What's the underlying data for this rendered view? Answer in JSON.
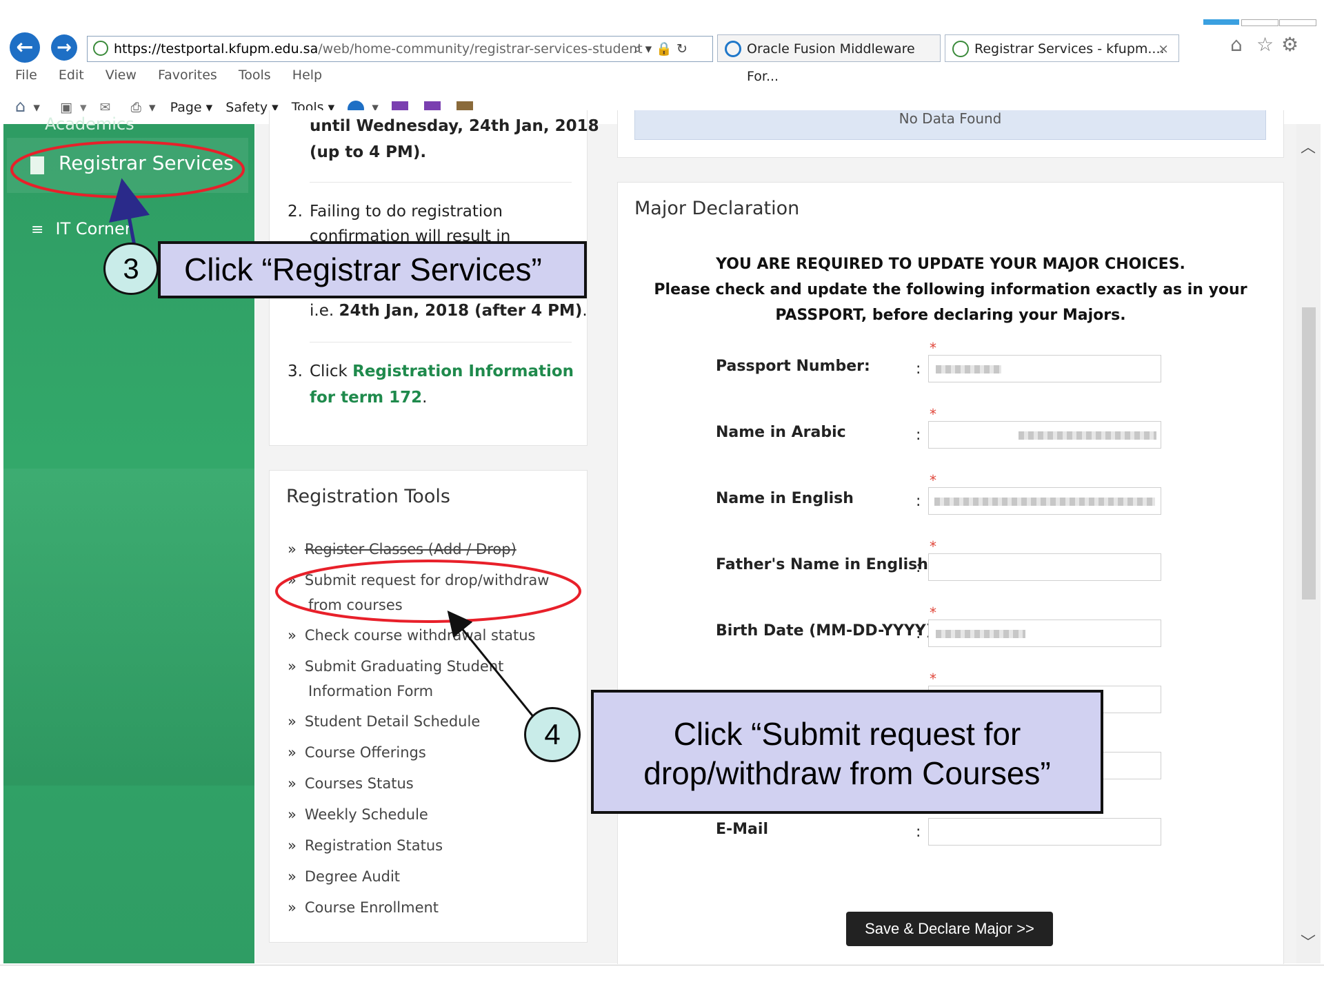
{
  "browser": {
    "url_host": "https://testportal.kfupm.edu.sa",
    "url_path": "/web/home-community/registrar-services-student",
    "addr_controls": "⌕ ▾ 🔒 ↻",
    "tabs": [
      {
        "label": "Oracle Fusion Middleware For..."
      },
      {
        "label": "Registrar Services - kfupm...."
      }
    ],
    "tab_close": "×",
    "menu": [
      "File",
      "Edit",
      "View",
      "Favorites",
      "Tools",
      "Help"
    ],
    "commands": [
      "Page ▾",
      "Safety ▾",
      "Tools ▾"
    ]
  },
  "sidebar": {
    "partial_item": "Academics",
    "items": [
      {
        "label": "Registrar Services"
      },
      {
        "label": "IT Corner"
      }
    ]
  },
  "steps": {
    "partial_line1": "until Wednesday, 24th Jan, 2018",
    "partial_line2": "(up to 4 PM).",
    "item2_num": "2.",
    "item2_line1": "Failing to do registration",
    "item2_line2": "confirmation will result in",
    "item2_line3_pre": "i.e. ",
    "item2_line3_bold": "24th Jan, 2018 (after 4 PM)",
    "item2_line3_post": ".",
    "item3_num": "3.",
    "item3_pre": "Click ",
    "item3_link1": "Registration Information",
    "item3_link2": "for term 172",
    "item3_post": "."
  },
  "tools_card": {
    "title": "Registration Tools",
    "chevron": "»",
    "items": [
      "Register Classes (Add / Drop)",
      "Submit request for drop/withdraw from courses",
      "Check course withdrawal status",
      "Submit Graduating Student Information Form",
      "Student Detail Schedule",
      "Course Offerings",
      "Courses Status",
      "Weekly Schedule",
      "Registration Status",
      "Degree Audit",
      "Course Enrollment"
    ]
  },
  "top_notice": "No Data Found",
  "major": {
    "title": "Major Declaration",
    "notice_line1": "YOU ARE REQUIRED TO UPDATE YOUR MAJOR CHOICES.",
    "notice_line2": "Please check and update the following information exactly as in your",
    "notice_line3": "PASSPORT, before declaring your Majors.",
    "required_mark": "*",
    "separator": ":",
    "fields": [
      {
        "label": "Passport Number:"
      },
      {
        "label": "Name in Arabic"
      },
      {
        "label": "Name in English"
      },
      {
        "label": "Father's Name in English"
      },
      {
        "label": "Birth Date (MM-DD-YYYY)"
      },
      {
        "label": ""
      },
      {
        "label": ""
      },
      {
        "label": "E-Mail"
      }
    ],
    "save_button": "Save & Declare Major >>"
  },
  "annotations": {
    "step3_number": "3",
    "step3_text": "Click “Registrar Services”",
    "step4_number": "4",
    "step4_line1": "Click “Submit request for",
    "step4_line2": "drop/withdraw from Courses”"
  },
  "scrollbar": {
    "up": "︿",
    "down": "﹀"
  },
  "colors": {
    "sidebar_green": "#33a86a",
    "link_green": "#1f8a4c",
    "annotation_red": "#e8202a",
    "callout_fill": "#d1d1f1"
  }
}
